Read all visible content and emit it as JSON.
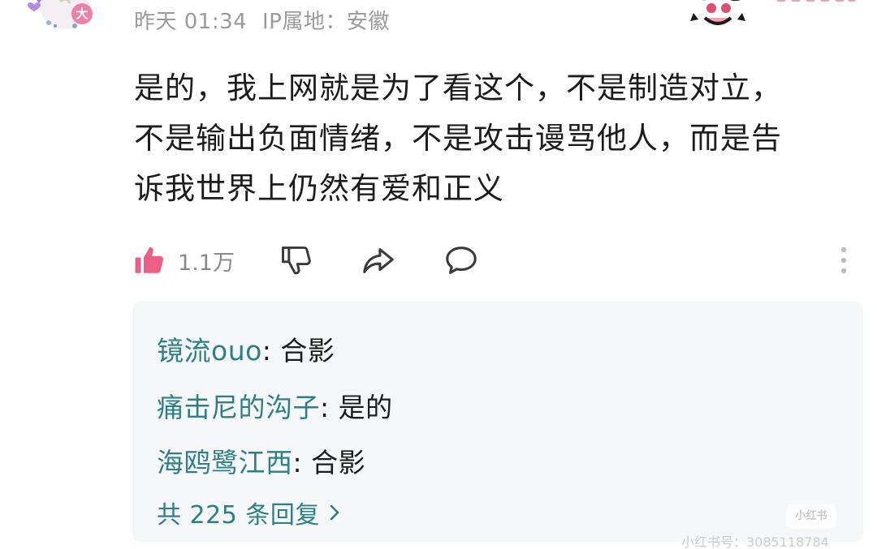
{
  "comment": {
    "author_badge": "大",
    "time": "昨天 01:34",
    "ip_location": "IP属地：安徽",
    "text_lines": [
      "是的，我上网就是为了看这个，不是制造对立，",
      "不是输出负面情绪，不是攻击谩骂他人，而是告",
      "诉我世界上仍然有爱和正义"
    ],
    "like_count": "1.1万",
    "icons": {
      "like": "thumbs-up-icon",
      "dislike": "thumbs-down-icon",
      "share": "share-icon",
      "reply": "comment-icon",
      "more": "more-vertical-icon"
    },
    "colors": {
      "like": "#ee5f87",
      "username": "#2f7f86",
      "meta": "#9a9a9a"
    }
  },
  "replies": [
    {
      "user": "镜流ouo",
      "separator": ": ",
      "text": "合影"
    },
    {
      "user": "痛击尼的沟子",
      "separator": ": ",
      "text": "是的"
    },
    {
      "user": "海鸥鹭江西",
      "separator": ": ",
      "text": "合影"
    }
  ],
  "more_replies": "共 225 条回复",
  "watermark": {
    "logo": "小红书",
    "text": "小红书号：3085118784"
  }
}
